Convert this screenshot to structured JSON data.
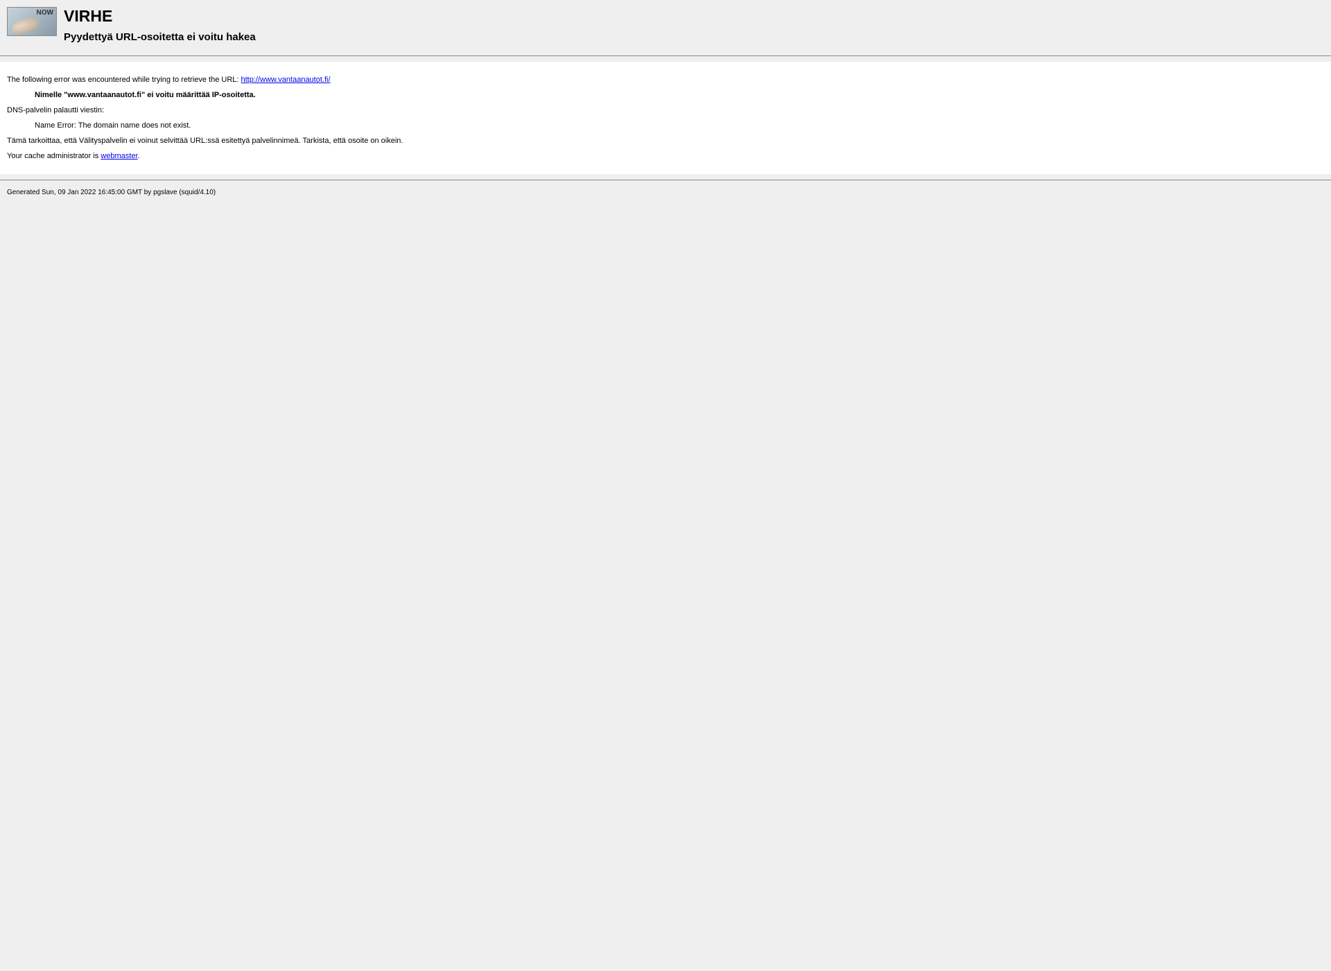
{
  "logo_text": "NOW",
  "header": {
    "title": "VIRHE",
    "subtitle": "Pyydettyä URL-osoitetta ei voitu hakea"
  },
  "content": {
    "error_intro": "The following error was encountered while trying to retrieve the URL: ",
    "error_url": "http://www.vantaanautot.fi/",
    "error_message": "Nimelle \"www.vantaanautot.fi\" ei voitu määrittää IP-osoitetta.",
    "dns_intro": "DNS-palvelin palautti viestin:",
    "dns_message": "Name Error: The domain name does not exist.",
    "explanation": "Tämä tarkoittaa, että Välityspalvelin ei voinut selvittää URL:ssä esitettyä palvelinnimeä. Tarkista, että osoite on oikein.",
    "admin_intro": "Your cache administrator is ",
    "admin_link": "webmaster",
    "admin_suffix": "."
  },
  "footer": {
    "generated": "Generated Sun, 09 Jan 2022 16:45:00 GMT by pgslave (squid/4.10)"
  }
}
